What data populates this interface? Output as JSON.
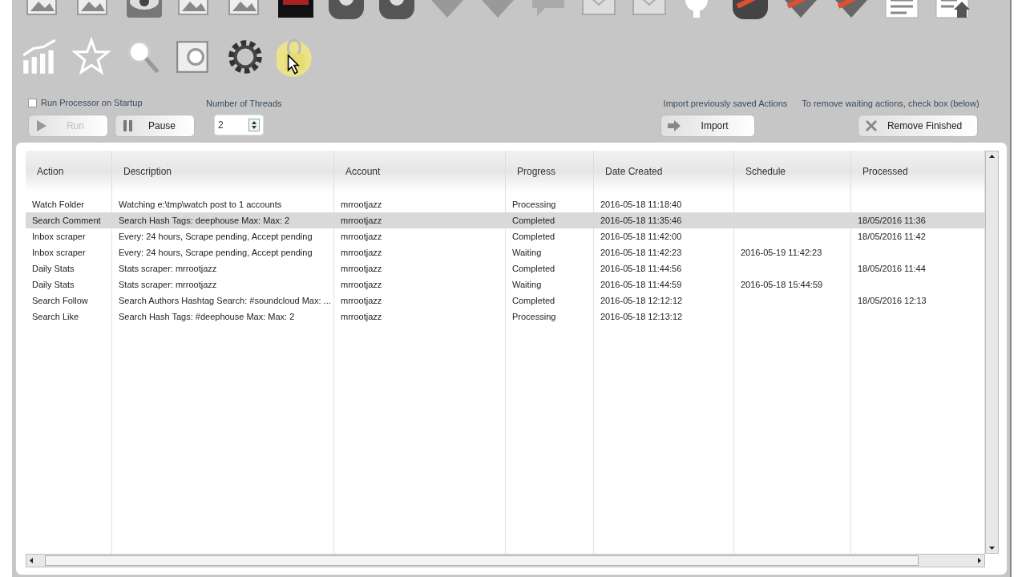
{
  "options": {
    "run_on_startup": {
      "label": "Run Processor on Startup",
      "checked": false
    },
    "threads": {
      "label": "Number of Threads",
      "value": "2"
    },
    "import_hint": "Import previously saved Actions",
    "remove_hint": "To remove waiting actions, check box (below)"
  },
  "buttons": [
    {
      "kind": "run",
      "label": "Run",
      "disabled": true
    },
    {
      "kind": "pause",
      "label": "Pause",
      "disabled": false
    },
    {
      "kind": "import",
      "label": "Import",
      "disabled": false
    },
    {
      "kind": "remove",
      "label": "Remove Finished",
      "disabled": false
    }
  ],
  "table": {
    "columns": [
      "Action",
      "Description",
      "Account",
      "Progress",
      "Date Created",
      "Schedule",
      "Processed"
    ],
    "rows": [
      {
        "selected": false,
        "cells": [
          "Watch Folder",
          "Watching e:\\tmp\\watch post to 1 accounts",
          "mrrootjazz",
          "Processing",
          "2016-05-18 11:18:40",
          "",
          ""
        ]
      },
      {
        "selected": true,
        "cells": [
          "Search Comment",
          "Search Hash Tags: deephouse Max: Max: 2",
          "mrrootjazz",
          "Completed",
          "2016-05-18 11:35:46",
          "",
          "18/05/2016 11:36"
        ]
      },
      {
        "selected": false,
        "cells": [
          "Inbox scraper",
          "Every: 24 hours, Scrape pending, Accept pending",
          "mrrootjazz",
          "Completed",
          "2016-05-18 11:42:00",
          "",
          "18/05/2016 11:42"
        ]
      },
      {
        "selected": false,
        "cells": [
          "Inbox scraper",
          "Every: 24 hours, Scrape pending, Accept pending",
          "mrrootjazz",
          "Waiting",
          "2016-05-18 11:42:23",
          "2016-05-19 11:42:23",
          ""
        ]
      },
      {
        "selected": false,
        "cells": [
          "Daily Stats",
          "Stats scraper: mrrootjazz",
          "mrrootjazz",
          "Completed",
          "2016-05-18 11:44:56",
          "",
          "18/05/2016 11:44"
        ]
      },
      {
        "selected": false,
        "cells": [
          "Daily Stats",
          "Stats scraper: mrrootjazz",
          "mrrootjazz",
          "Waiting",
          "2016-05-18 11:44:59",
          "2016-05-18 15:44:59",
          ""
        ]
      },
      {
        "selected": false,
        "cells": [
          "Search Follow",
          "Search Authors Hashtag Search: #soundcloud Max: ...",
          "mrrootjazz",
          "Completed",
          "2016-05-18 12:12:12",
          "",
          "18/05/2016 12:13"
        ]
      },
      {
        "selected": false,
        "cells": [
          "Search Like",
          "Search Hash Tags: #deephouse Max: Max: 2",
          "mrrootjazz",
          "Processing",
          "2016-05-18 12:13:12",
          "",
          ""
        ]
      }
    ]
  }
}
